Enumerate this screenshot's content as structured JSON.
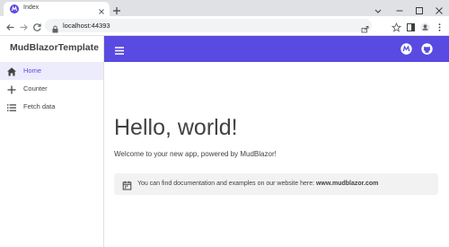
{
  "browser": {
    "tab_title": "Index",
    "url": "localhost:44393"
  },
  "app": {
    "brand": "MudBlazorTemplate",
    "accent_color": "#594ae2",
    "nav": [
      {
        "label": "Home",
        "icon": "home-icon",
        "active": true
      },
      {
        "label": "Counter",
        "icon": "plus-icon",
        "active": false
      },
      {
        "label": "Fetch data",
        "icon": "list-icon",
        "active": false
      }
    ],
    "main": {
      "heading": "Hello, world!",
      "welcome": "Welcome to your new app, powered by MudBlazor!",
      "alert_text": "You can find documentation and examples on our website here: ",
      "alert_link": "www.mudblazor.com"
    }
  }
}
